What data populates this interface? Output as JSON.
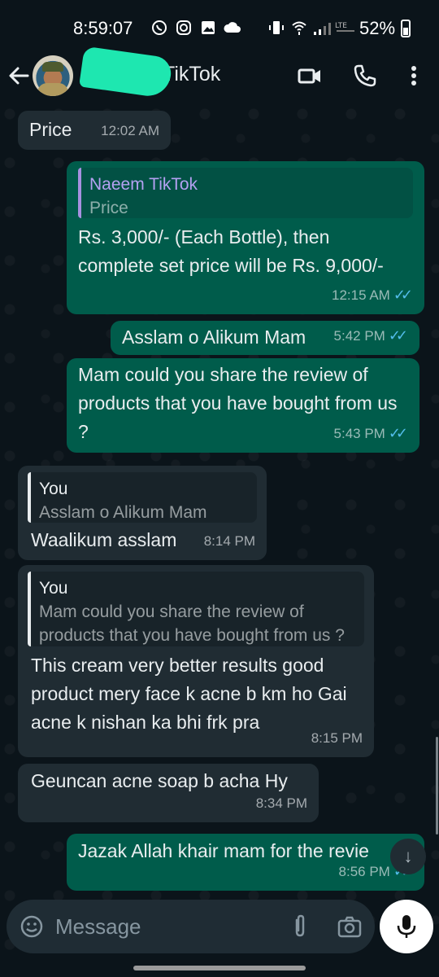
{
  "status_bar": {
    "time": "8:59:07",
    "battery": "52%",
    "icons": [
      "whatsapp-icon",
      "instagram-icon",
      "gallery-icon",
      "cloud-icon",
      "vibrate-icon",
      "wifi-icon",
      "signal-icon",
      "lte-icon",
      "battery-icon"
    ]
  },
  "header": {
    "contact_name_visible": "TikTok",
    "icons": [
      "back-arrow-icon",
      "video-call-icon",
      "phone-call-icon",
      "more-options-icon"
    ]
  },
  "messages": [
    {
      "dir": "in",
      "text": "Price",
      "time": "12:02 AM"
    },
    {
      "dir": "out",
      "quote_author": "Naeem TikTok",
      "quote_text": "Price",
      "text": "Rs. 3,000/- (Each Bottle), then complete set price will be Rs. 9,000/-",
      "time": "12:15 AM",
      "ticks": "✓✓"
    },
    {
      "dir": "out",
      "text": "Asslam o Alikum Mam",
      "time": "5:42 PM",
      "ticks": "✓✓"
    },
    {
      "dir": "out",
      "text": "Mam could you share the review of products that you have bought from us ?",
      "time": "5:43 PM",
      "ticks": "✓✓"
    },
    {
      "dir": "in",
      "quote_author": "You",
      "quote_text": "Asslam o Alikum Mam",
      "text": "Waalikum asslam",
      "time": "8:14 PM"
    },
    {
      "dir": "in",
      "quote_author": "You",
      "quote_text": "Mam could you share the review of products that you have bought from us ?",
      "text": "This cream very better results good product mery face k acne b km ho Gai acne k nishan ka bhi frk pra",
      "time": "8:15 PM"
    },
    {
      "dir": "in",
      "text": "Geuncan acne soap b acha Hy",
      "time": "8:34 PM"
    },
    {
      "dir": "out",
      "text": "Jazak Allah khair mam for the revie",
      "time": "8:56 PM",
      "ticks": "✓✓"
    }
  ],
  "input": {
    "placeholder": "Message"
  },
  "colors": {
    "background": "#0b141a",
    "incoming_bubble": "#202c33",
    "outgoing_bubble": "#005c4b",
    "read_ticks": "#53bdeb",
    "quote_bar_out": "#a791e0"
  }
}
